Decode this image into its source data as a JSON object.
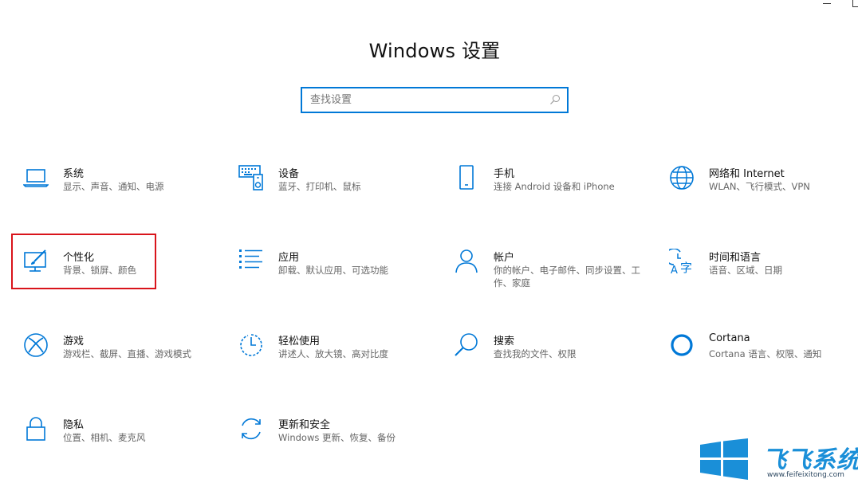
{
  "header": {
    "title": "Windows 设置"
  },
  "search": {
    "placeholder": "查找设置"
  },
  "tiles": [
    {
      "name": "系统",
      "desc": "显示、声音、通知、电源",
      "icon": "laptop-icon"
    },
    {
      "name": "设备",
      "desc": "蓝牙、打印机、鼠标",
      "icon": "keyboard-icon"
    },
    {
      "name": "手机",
      "desc": "连接 Android 设备和 iPhone",
      "icon": "phone-icon"
    },
    {
      "name": "网络和 Internet",
      "desc": "WLAN、飞行模式、VPN",
      "icon": "globe-icon"
    },
    {
      "name": "个性化",
      "desc": "背景、锁屏、颜色",
      "icon": "paint-brush-icon"
    },
    {
      "name": "应用",
      "desc": "卸载、默认应用、可选功能",
      "icon": "apps-list-icon"
    },
    {
      "name": "帐户",
      "desc": "你的帐户、电子邮件、同步设置、工作、家庭",
      "icon": "person-icon"
    },
    {
      "name": "时间和语言",
      "desc": "语音、区域、日期",
      "icon": "time-language-icon"
    },
    {
      "name": "游戏",
      "desc": "游戏栏、截屏、直播、游戏模式",
      "icon": "xbox-icon"
    },
    {
      "name": "轻松使用",
      "desc": "讲述人、放大镜、高对比度",
      "icon": "ease-of-access-icon"
    },
    {
      "name": "搜索",
      "desc": "查找我的文件、权限",
      "icon": "magnifier-icon"
    },
    {
      "name": "Cortana",
      "desc": "Cortana 语言、权限、通知",
      "icon": "cortana-icon"
    },
    {
      "name": "隐私",
      "desc": "位置、相机、麦克风",
      "icon": "lock-icon"
    },
    {
      "name": "更新和安全",
      "desc": "Windows 更新、恢复、备份",
      "icon": "sync-icon"
    }
  ],
  "watermark": {
    "text": "飞飞系统",
    "url": "www.feifeixitong.com"
  },
  "colors": {
    "accent": "#0078d7",
    "highlight": "#d9141b",
    "watermark": "#1a8fd8"
  }
}
